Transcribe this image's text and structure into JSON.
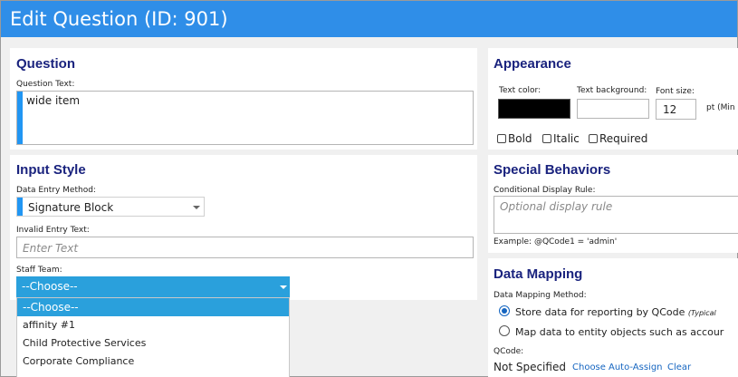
{
  "window": {
    "title": "Edit Question (ID: 901)"
  },
  "question": {
    "heading": "Question",
    "text_label": "Question Text:",
    "text_value": "wide item"
  },
  "input_style": {
    "heading": "Input Style",
    "method_label": "Data Entry Method:",
    "method_value": "Signature Block",
    "invalid_label": "Invalid Entry Text:",
    "invalid_placeholder": "Enter Text",
    "staff_label": "Staff Team:",
    "staff_value": "--Choose--",
    "staff_options": [
      "--Choose--",
      "affinity #1",
      "Child Protective Services",
      "Corporate Compliance"
    ]
  },
  "appearance": {
    "heading": "Appearance",
    "text_color_label": "Text color:",
    "text_bg_label": "Text background:",
    "font_size_label": "Font size:",
    "font_size_value": "12",
    "pt_suffix": "pt (Min",
    "bold_label": "Bold",
    "italic_label": "Italic",
    "required_label": "Required",
    "text_color": "#000000"
  },
  "special": {
    "heading": "Special Behaviors",
    "rule_label": "Conditional Display Rule:",
    "rule_placeholder": "Optional display rule",
    "example": "Example: @QCode1 = 'admin'"
  },
  "mapping": {
    "heading": "Data Mapping",
    "method_label": "Data Mapping Method:",
    "option1": "Store data for reporting by QCode",
    "option1_note": "(Typical",
    "option2": "Map data to entity objects such as accour",
    "qcode_label": "QCode:",
    "qcode_value": "Not Specified",
    "choose_link": "Choose",
    "auto_link": "Auto-Assign",
    "clear_link": "Clear"
  },
  "colors": {
    "accent": "#2196f3",
    "title_bar": "#2f8ee8",
    "heading": "#1a237e",
    "dropdown_selected": "#2aa0dc"
  }
}
